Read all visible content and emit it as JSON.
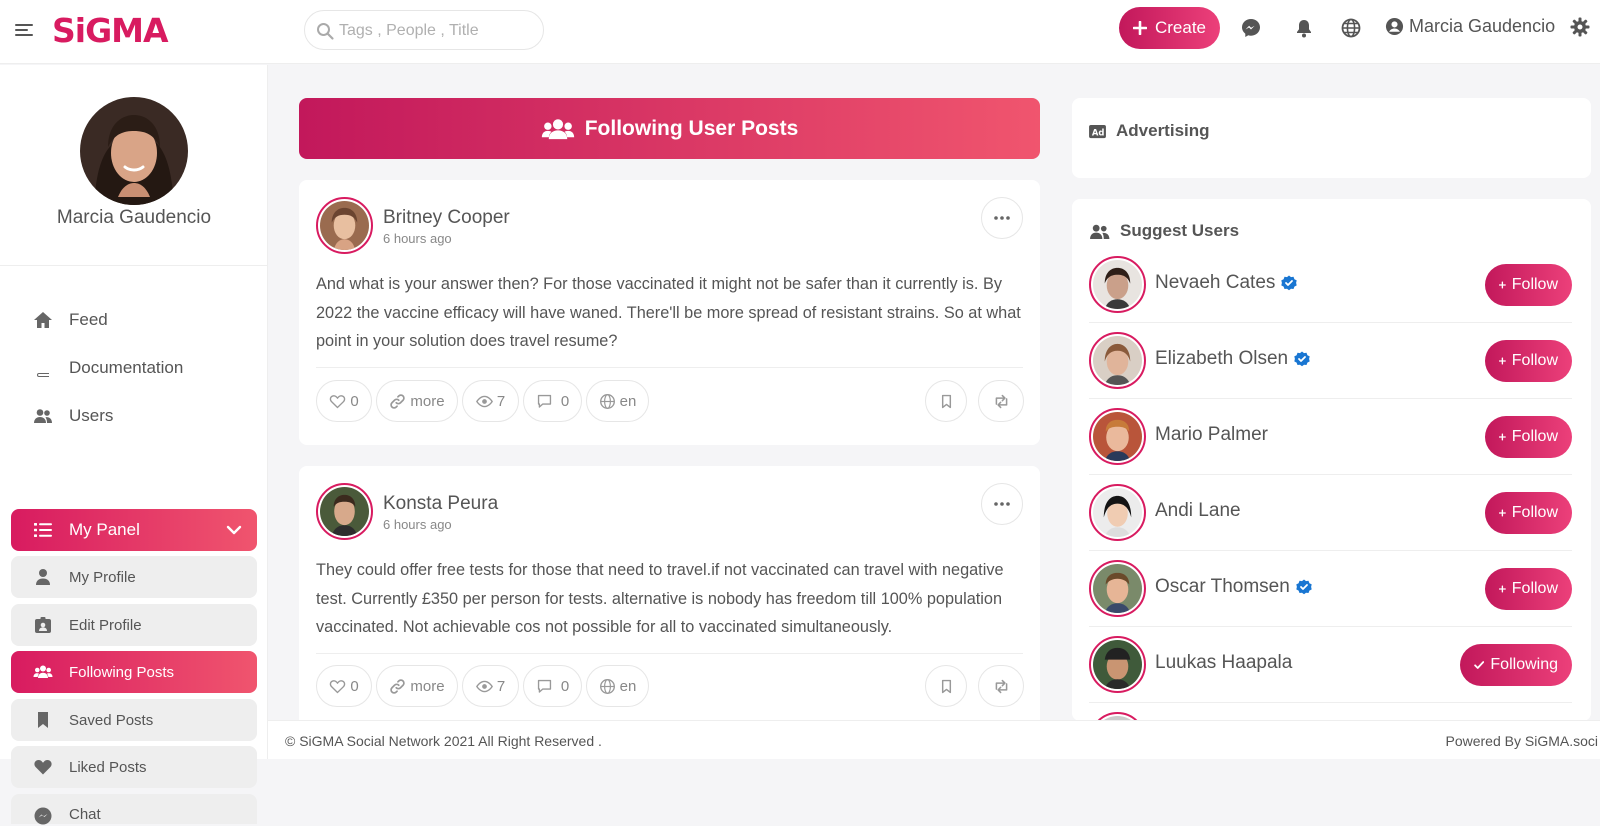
{
  "brand": {
    "logo": "SiGMA",
    "accent": "#d81b60",
    "accent_end": "#f0556e"
  },
  "search": {
    "placeholder": "Tags , People , Title"
  },
  "topbar": {
    "create_label": "Create",
    "user_name": "Marcia Gaudencio",
    "icons": [
      "menu-icon",
      "messenger-icon",
      "bell-icon",
      "globe-icon",
      "user-circle-icon",
      "gear-icon"
    ]
  },
  "sidebar": {
    "profile_name": "Marcia Gaudencio",
    "nav": [
      {
        "label": "Feed",
        "icon": "home-icon"
      },
      {
        "label": "Documentation",
        "icon": "book-icon"
      },
      {
        "label": "Users",
        "icon": "users-icon"
      },
      {
        "label": "My Panel",
        "icon": "list-icon"
      }
    ],
    "panel": [
      {
        "label": "My Profile",
        "icon": "user-icon"
      },
      {
        "label": "Edit Profile",
        "icon": "id-card-icon"
      },
      {
        "label": "Following Posts",
        "icon": "users-icon"
      },
      {
        "label": "Saved Posts",
        "icon": "bookmark-icon"
      },
      {
        "label": "Liked Posts",
        "icon": "heart-icon"
      },
      {
        "label": "Chat",
        "icon": "chat-icon"
      }
    ]
  },
  "main": {
    "banner_title": "Following User Posts",
    "posts": [
      {
        "author": "Britney Cooper",
        "time": "6 hours ago",
        "text": "And what is your answer then? For those vaccinated it might not be safer than it currently is. By 2022 the vaccine efficacy will have waned. There'll be more spread of resistant strains. So at what point in your solution does travel resume?",
        "likes": "0",
        "more": "more",
        "views": "7",
        "comments": "0",
        "lang": "en"
      },
      {
        "author": "Konsta Peura",
        "time": "6 hours ago",
        "text": "They could offer free tests for those that need to travel.if not vaccinated can travel with negative test. Currently £350 per person for tests. alternative is nobody has freedom till 100% population vaccinated. Not achievable cos not possible for all to vaccinated simultaneously.",
        "likes": "0",
        "more": "more",
        "views": "7",
        "comments": "0",
        "lang": "en"
      }
    ]
  },
  "right": {
    "advertising_title": "Advertising",
    "suggest_title": "Suggest Users",
    "users": [
      {
        "name": "Nevaeh Cates",
        "verified": true,
        "action": "Follow"
      },
      {
        "name": "Elizabeth Olsen",
        "verified": true,
        "action": "Follow"
      },
      {
        "name": "Mario Palmer",
        "verified": false,
        "action": "Follow"
      },
      {
        "name": "Andi Lane",
        "verified": false,
        "action": "Follow"
      },
      {
        "name": "Oscar Thomsen",
        "verified": true,
        "action": "Follow"
      },
      {
        "name": "Luukas Haapala",
        "verified": false,
        "action": "Following"
      }
    ]
  },
  "footer": {
    "copyright": "© SiGMA Social Network 2021 All Right Reserved .",
    "powered": "Powered By SiGMA.soci"
  }
}
